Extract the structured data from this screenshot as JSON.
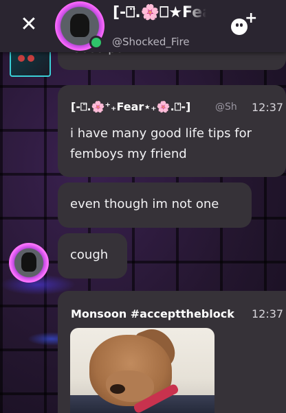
{
  "header": {
    "close_glyph": "✕",
    "title": "[-⎕̈.🌸⎕★Fear★.🌸.⎕̈-]",
    "handle": "@Shocked_Fire",
    "online": true,
    "add_friend_plus": "+"
  },
  "messages": [
    {
      "id": "m0",
      "text": "Good point"
    },
    {
      "id": "m1",
      "author": "[-⎕̈.🌸⁺₊Fear⋆₊🌸.⎕̈-]",
      "handle": "@Sh",
      "time": "12:37",
      "text": "i have many good life tips for femboys my friend"
    },
    {
      "id": "m2",
      "text": "even though im not one"
    },
    {
      "id": "m3",
      "text": "cough"
    },
    {
      "id": "m4",
      "author": "Monsoon #accepttheblock",
      "time": "12:37",
      "attachment": "dog-photo"
    }
  ],
  "colors": {
    "header_bg": "#2a2530",
    "bubble_bg": "#363238",
    "avatar_ring": "#ff6bff",
    "online": "#2fc56a"
  }
}
